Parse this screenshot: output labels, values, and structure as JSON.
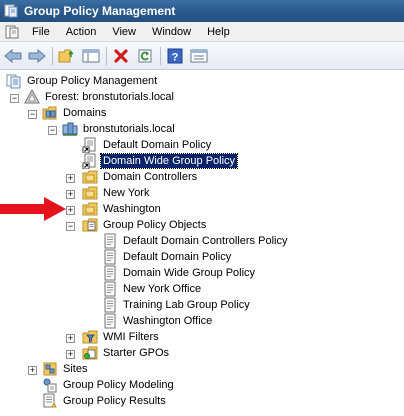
{
  "window": {
    "title": "Group Policy Management"
  },
  "menu": {
    "items": [
      "File",
      "Action",
      "View",
      "Window",
      "Help"
    ]
  },
  "toolbar": {
    "buttons": [
      "back-icon",
      "forward-icon",
      "up-folder-icon",
      "show-hide-tree-icon",
      "delete-icon",
      "refresh-icon",
      "help-icon",
      "properties-icon"
    ]
  },
  "tree": {
    "root": "Group Policy Management",
    "forest": "Forest: bronstutorials.local",
    "domains": "Domains",
    "domain": "bronstutorials.local",
    "default_domain_policy": "Default Domain Policy",
    "domain_wide_group_policy": "Domain Wide Group Policy",
    "domain_controllers": "Domain Controllers",
    "new_york": "New York",
    "washington": "Washington",
    "group_policy_objects": "Group Policy Objects",
    "gpos": [
      "Default Domain Controllers Policy",
      "Default Domain Policy",
      "Domain Wide Group Policy",
      "New York Office",
      "Training Lab Group Policy",
      "Washington Office"
    ],
    "wmi_filters": "WMI Filters",
    "starter_gpos": "Starter GPOs",
    "sites": "Sites",
    "modeling": "Group Policy Modeling",
    "results": "Group Policy Results",
    "selected": "Domain Wide Group Policy"
  },
  "colors": {
    "titlebar": "#2c5c8f",
    "selection": "#0a246a",
    "arrow": "#e3141b",
    "folder": "#f2c75c"
  }
}
